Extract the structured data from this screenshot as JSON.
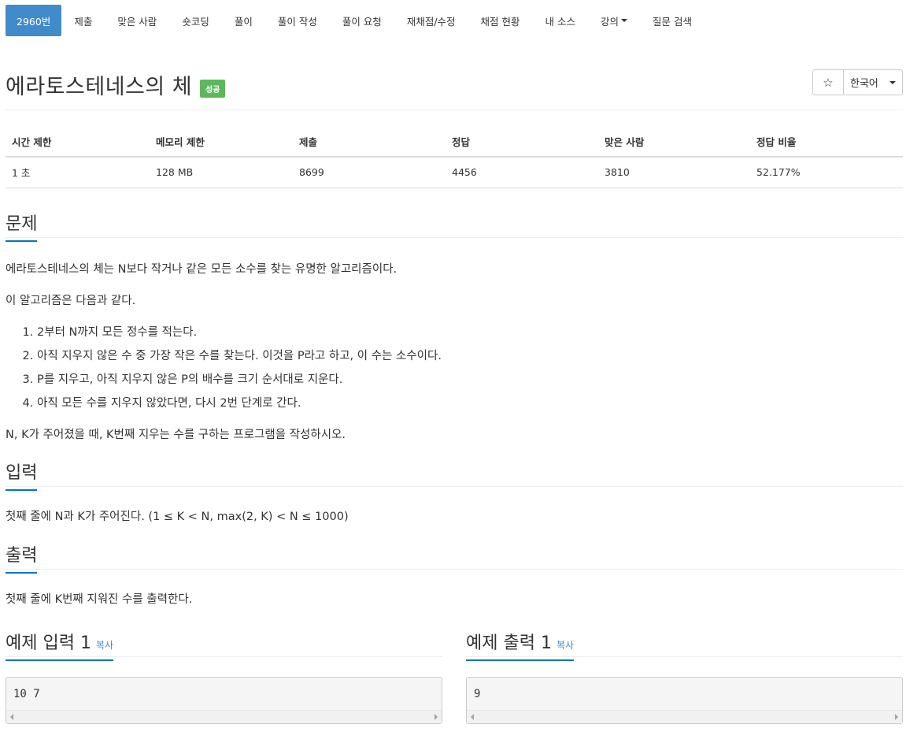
{
  "nav": {
    "items": [
      {
        "label": "2960번"
      },
      {
        "label": "제출"
      },
      {
        "label": "맞은 사람"
      },
      {
        "label": "숏코딩"
      },
      {
        "label": "풀이"
      },
      {
        "label": "풀이 작성"
      },
      {
        "label": "풀이 요청"
      },
      {
        "label": "재채점/수정"
      },
      {
        "label": "채점 현황"
      },
      {
        "label": "내 소스"
      },
      {
        "label": "강의"
      },
      {
        "label": "질문 검색"
      }
    ]
  },
  "problem": {
    "title": "에라토스테네스의 체",
    "badge": "성공",
    "star_glyph": "☆",
    "language": "한국어"
  },
  "info_table": {
    "headers": [
      "시간 제한",
      "메모리 제한",
      "제출",
      "정답",
      "맞은 사람",
      "정답 비율"
    ],
    "row": [
      "1 초",
      "128 MB",
      "8699",
      "4456",
      "3810",
      "52.177%"
    ]
  },
  "statement": {
    "heading": "문제",
    "intro": "에라토스테네스의 체는 N보다 작거나 같은 모든 소수를 찾는 유명한 알고리즘이다.",
    "algo_intro": "이 알고리즘은 다음과 같다.",
    "steps": [
      "2부터 N까지 모든 정수를 적는다.",
      "아직 지우지 않은 수 중 가장 작은 수를 찾는다. 이것을 P라고 하고, 이 수는 소수이다.",
      "P를 지우고, 아직 지우지 않은 P의 배수를 크기 순서대로 지운다.",
      "아직 모든 수를 지우지 않았다면, 다시 2번 단계로 간다."
    ],
    "question": "N, K가 주어졌을 때, K번째 지우는 수를 구하는 프로그램을 작성하시오."
  },
  "input_section": {
    "heading": "입력",
    "text": "첫째 줄에 N과 K가 주어진다. (1 ≤ K < N, max(2, K) < N ≤ 1000)"
  },
  "output_section": {
    "heading": "출력",
    "text": "첫째 줄에 K번째 지워진 수를 출력한다."
  },
  "samples": {
    "input_heading": "예제 입력 1",
    "output_heading": "예제 출력 1",
    "copy_label": "복사",
    "input_value": "10 7",
    "output_value": "9"
  },
  "colors": {
    "active_tab": "#428bca",
    "badge_success": "#5cb85c",
    "section_underline": "#0076c0",
    "link": "#428bca"
  }
}
